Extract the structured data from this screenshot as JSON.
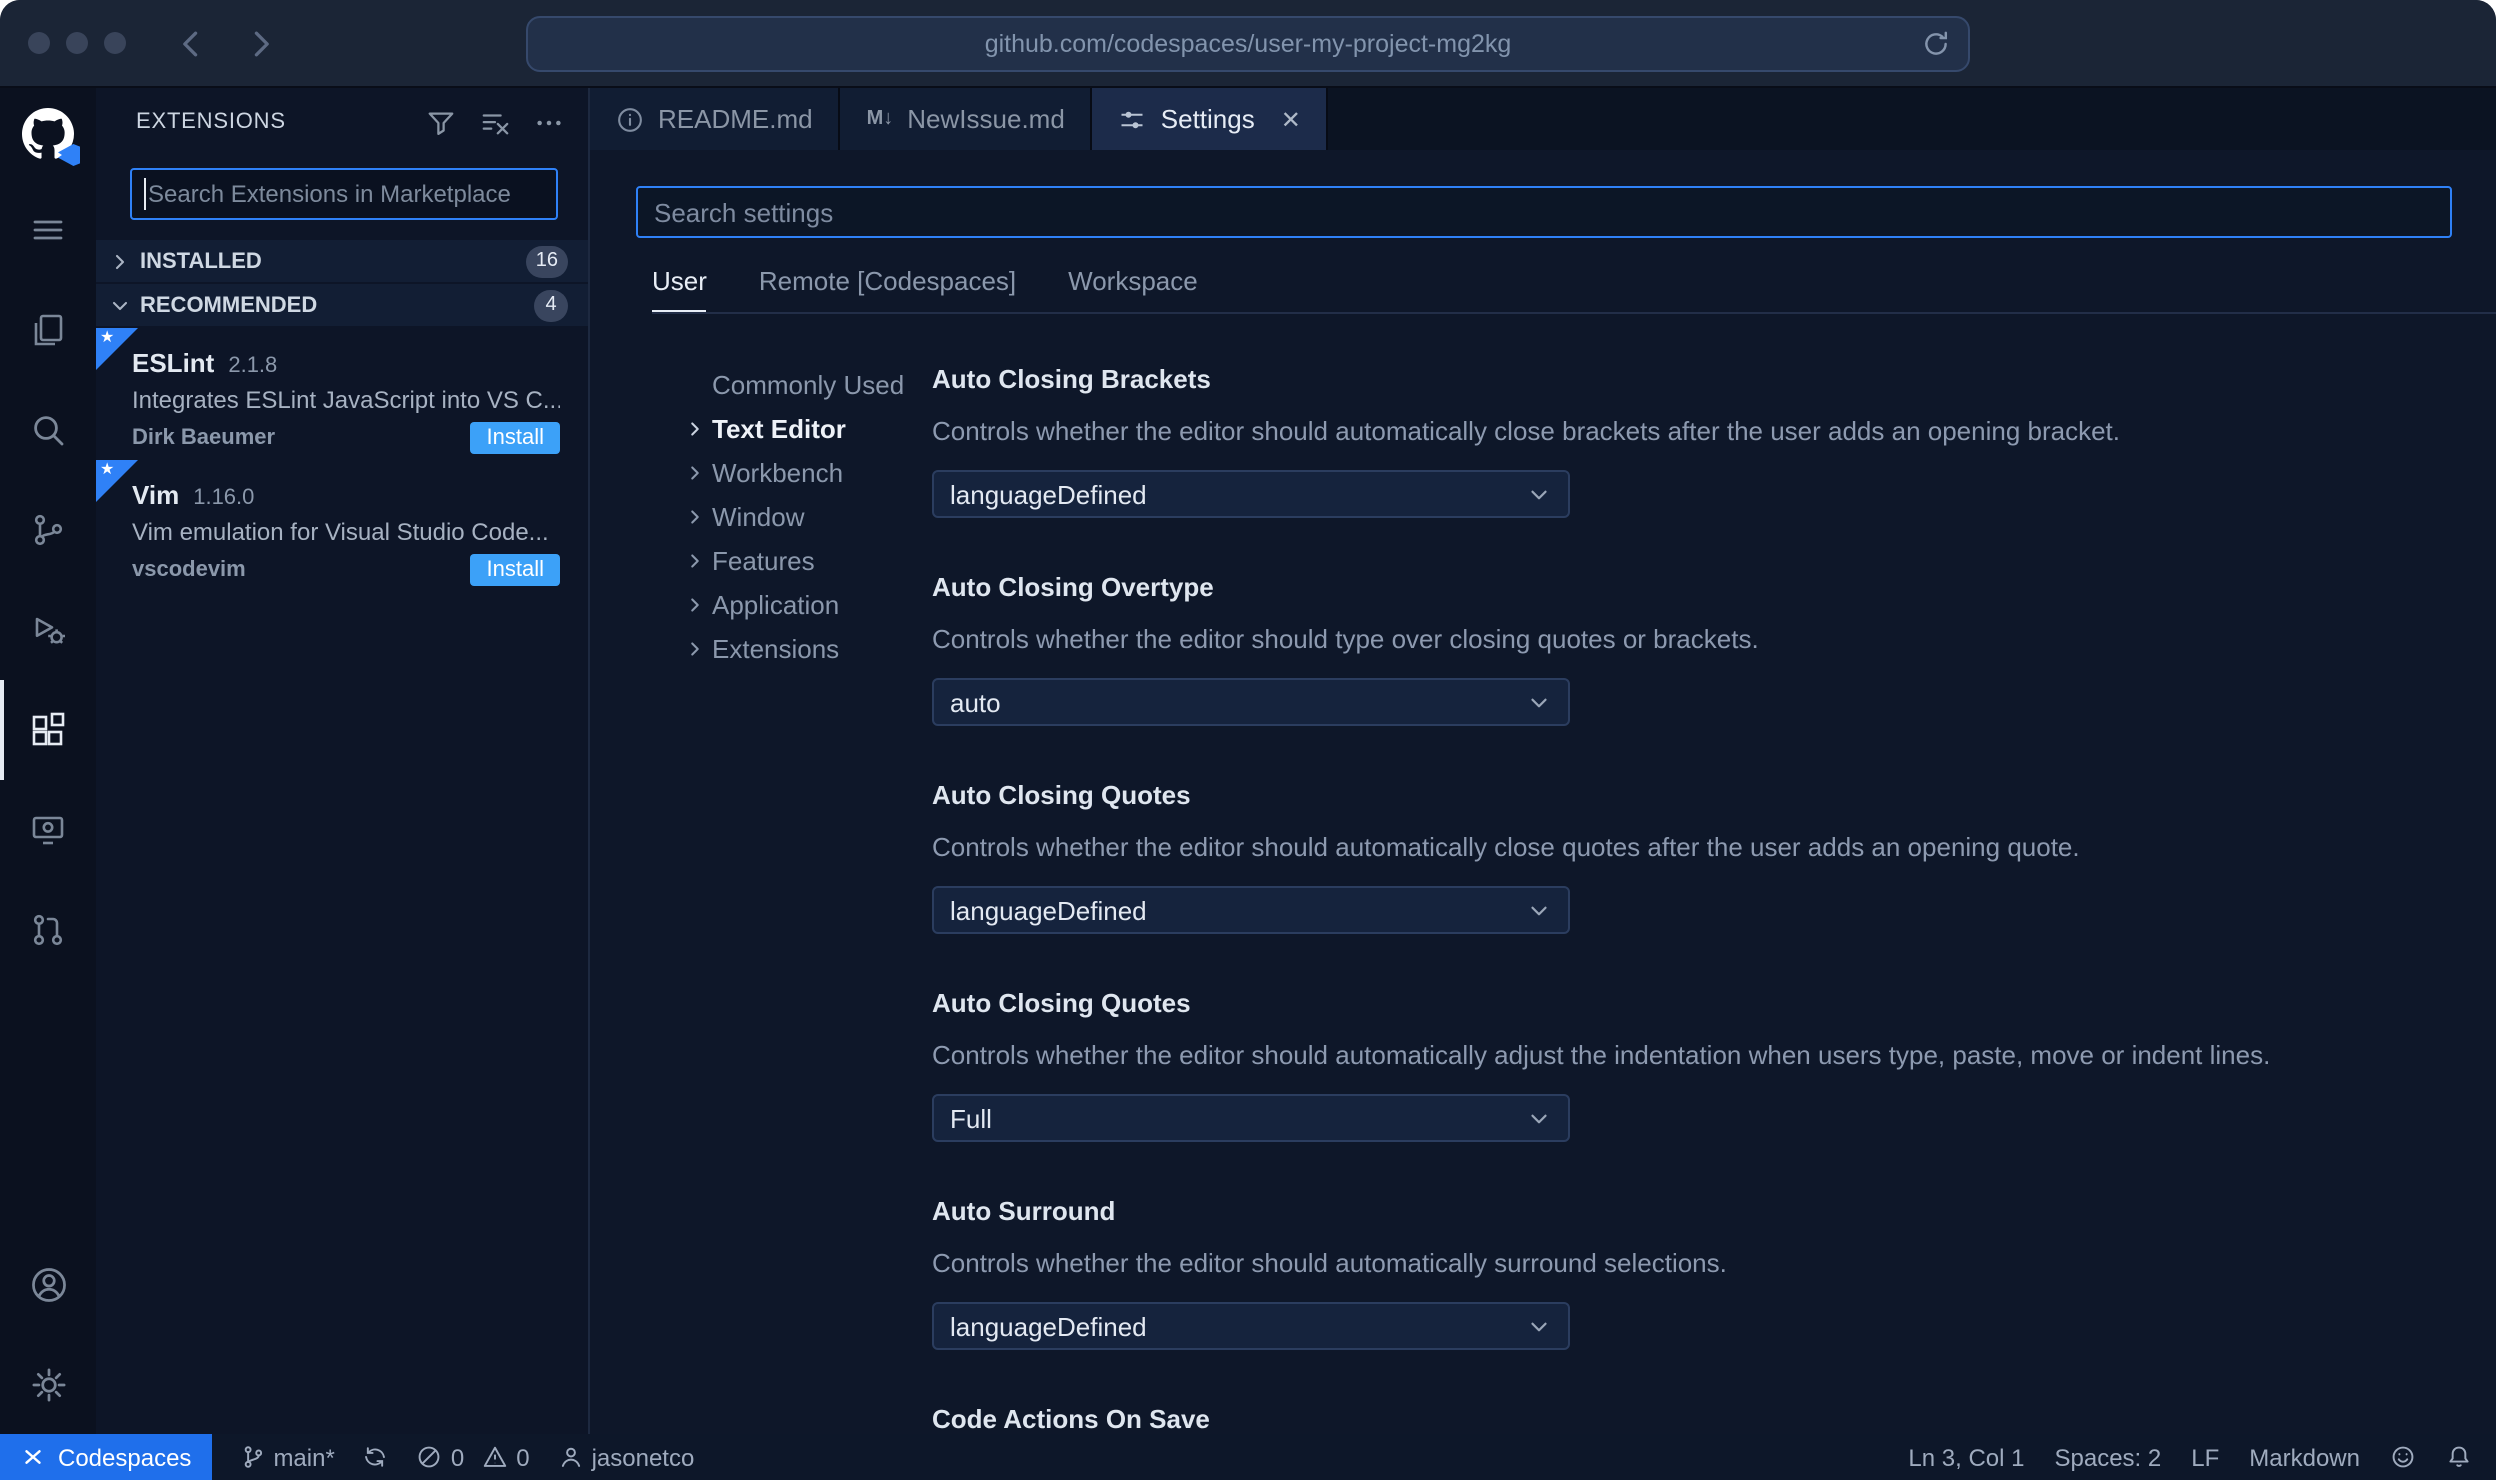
{
  "theme": {
    "accent_blue": "#2f81f7",
    "install_button_blue": "#3ca1f8",
    "codespaces_statusbar_blue": "#1f6feb",
    "background_navy": "#0e1729"
  },
  "browser": {
    "url": "github.com/codespaces/user-my-project-mg2kg"
  },
  "sidebar": {
    "title": "EXTENSIONS",
    "search_placeholder": "Search Extensions in Marketplace",
    "sections": [
      {
        "label": "INSTALLED",
        "count": "16"
      },
      {
        "label": "RECOMMENDED",
        "count": "4"
      }
    ],
    "extensions": [
      {
        "name": "ESLint",
        "version": "2.1.8",
        "description": "Integrates ESLint JavaScript into VS C...",
        "publisher": "Dirk Baeumer",
        "action": "Install"
      },
      {
        "name": "Vim",
        "version": "1.16.0",
        "description": "Vim emulation for Visual Studio Code...",
        "publisher": "vscodevim",
        "action": "Install"
      }
    ]
  },
  "editor": {
    "tabs": [
      {
        "label": "README.md"
      },
      {
        "label": "NewIssue.md"
      },
      {
        "label": "Settings"
      }
    ],
    "markdown_icon_text": "M↓",
    "close_glyph": "✕"
  },
  "settings": {
    "search_placeholder": "Search settings",
    "scopes": [
      {
        "label": "User"
      },
      {
        "label": "Remote [Codespaces]"
      },
      {
        "label": "Workspace"
      }
    ],
    "toc": [
      {
        "label": "Commonly Used"
      },
      {
        "label": "Text Editor"
      },
      {
        "label": "Workbench"
      },
      {
        "label": "Window"
      },
      {
        "label": "Features"
      },
      {
        "label": "Application"
      },
      {
        "label": "Extensions"
      }
    ],
    "items": [
      {
        "title": "Auto Closing Brackets",
        "description": "Controls whether the editor should automatically close brackets after the user adds an opening bracket.",
        "value": "languageDefined"
      },
      {
        "title": "Auto Closing Overtype",
        "description": "Controls whether the editor should type over closing quotes or brackets.",
        "value": "auto"
      },
      {
        "title": "Auto Closing Quotes",
        "description": "Controls whether the editor should automatically close quotes after the user adds an opening quote.",
        "value": "languageDefined"
      },
      {
        "title": "Auto Closing Quotes",
        "description": "Controls whether the editor should automatically adjust the indentation when users type, paste, move or indent lines.",
        "value": "Full"
      },
      {
        "title": "Auto Surround",
        "description": "Controls whether the editor should automatically surround selections.",
        "value": "languageDefined"
      },
      {
        "title": "Code Actions On Save"
      }
    ]
  },
  "status_bar": {
    "codespaces": "Codespaces",
    "branch": "main*",
    "errors": "0",
    "warnings": "0",
    "user": "jasonetco",
    "line_col": "Ln 3, Col 1",
    "spaces": "Spaces: 2",
    "eol": "LF",
    "language": "Markdown",
    "star_glyph": "★"
  }
}
